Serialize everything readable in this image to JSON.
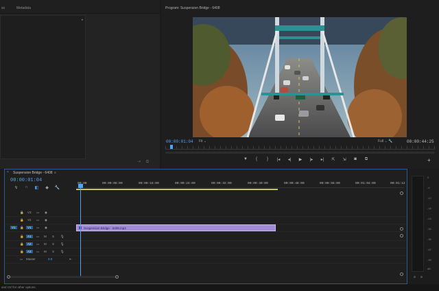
{
  "source_panel": {
    "tabs": [
      "ss",
      "Metadata"
    ],
    "footer": "⇥ ⧉"
  },
  "program_monitor": {
    "title": "Program: Suspension Bridge - 6408",
    "timecode_current": "00:00:01:04",
    "fit": "Fit",
    "resolution": "Full",
    "timecode_duration": "00:00:44:25",
    "controls": [
      "mark-in",
      "mark-out",
      "go-to-in",
      "step-back",
      "play",
      "step-forward",
      "go-to-out",
      "lift",
      "extract",
      "export-frame",
      "compare"
    ],
    "control_glyphs": [
      "▼",
      "{",
      "}",
      "|◂",
      "◂|",
      "▶",
      "|▸",
      "▸|",
      "⇱",
      "⇲",
      "◙",
      "⧉"
    ],
    "add_label": "+"
  },
  "timeline": {
    "title": "Suspension Bridge - 6408",
    "menu": "≡",
    "close": "×",
    "timecode": "00:00:01:04",
    "tools": [
      "↯",
      "∩",
      "◧",
      "◆",
      "🔧"
    ],
    "ruler_labels": [
      "00:00",
      "00:00:08:00",
      "00:00:16:00",
      "00:00:24:00",
      "00:00:32:00",
      "00:00:40:00",
      "00:00:48:00",
      "00:00:56:00",
      "00:01:04:00",
      "00:01:12"
    ],
    "tracks": [
      {
        "id": "V3",
        "type": "video"
      },
      {
        "id": "V2",
        "type": "video"
      },
      {
        "id": "V1",
        "type": "video",
        "source": "V1"
      },
      {
        "id": "A1",
        "type": "audio",
        "m": "M",
        "s": "S"
      },
      {
        "id": "A2",
        "type": "audio",
        "m": "M",
        "s": "S"
      },
      {
        "id": "A3",
        "type": "audio",
        "m": "M",
        "s": "S"
      }
    ],
    "master_label": "Master",
    "master_value": "0.0",
    "clip": {
      "label": "Suspension Bridge - 6408.mp4",
      "color": "#a28cd6"
    },
    "accent": "#4ea3ff"
  },
  "audio_meter": {
    "scale": [
      "0",
      "-6",
      "-12",
      "-18",
      "-24",
      "-30",
      "-36",
      "-42",
      "-48",
      "dB"
    ],
    "solo_left": "S",
    "solo_right": "S"
  },
  "status_bar": {
    "text": "and Ctrl for other options."
  }
}
